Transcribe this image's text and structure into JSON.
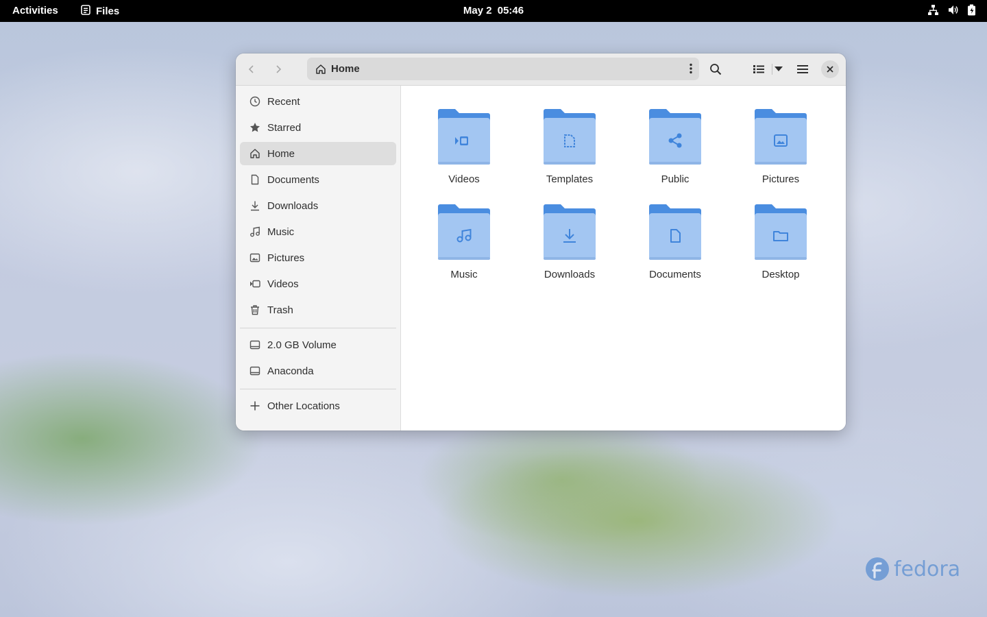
{
  "topbar": {
    "activities": "Activities",
    "app_name": "Files",
    "date": "May 2",
    "time": "05:46",
    "status_icons": [
      "network-icon",
      "volume-icon",
      "battery-icon"
    ]
  },
  "window": {
    "path": "Home",
    "buttons": [
      "back",
      "forward",
      "path-menu",
      "search",
      "view-toggle",
      "view-options",
      "main-menu",
      "close"
    ]
  },
  "sidebar": {
    "items": [
      {
        "label": "Recent",
        "icon": "clock-icon"
      },
      {
        "label": "Starred",
        "icon": "star-icon"
      },
      {
        "label": "Home",
        "icon": "home-icon",
        "active": true
      },
      {
        "label": "Documents",
        "icon": "document-icon"
      },
      {
        "label": "Downloads",
        "icon": "download-icon"
      },
      {
        "label": "Music",
        "icon": "music-icon"
      },
      {
        "label": "Pictures",
        "icon": "picture-icon"
      },
      {
        "label": "Videos",
        "icon": "video-icon"
      },
      {
        "label": "Trash",
        "icon": "trash-icon"
      }
    ],
    "devices": [
      {
        "label": "2.0 GB Volume",
        "icon": "drive-icon"
      },
      {
        "label": "Anaconda",
        "icon": "drive-icon"
      }
    ],
    "other": {
      "label": "Other Locations",
      "icon": "plus-icon"
    }
  },
  "files": [
    {
      "name": "Videos",
      "emblem": "video-icon"
    },
    {
      "name": "Templates",
      "emblem": "template-icon"
    },
    {
      "name": "Public",
      "emblem": "share-icon"
    },
    {
      "name": "Pictures",
      "emblem": "picture-icon"
    },
    {
      "name": "Music",
      "emblem": "music-icon"
    },
    {
      "name": "Downloads",
      "emblem": "download-icon"
    },
    {
      "name": "Documents",
      "emblem": "document-icon"
    },
    {
      "name": "Desktop",
      "emblem": "folder-icon"
    }
  ],
  "colors": {
    "folder_back": "#4a8de0",
    "folder_front": "#a3c6f2",
    "folder_emblem": "#3f84db",
    "accent": "#3584e4"
  },
  "wallpaper": {
    "brand": "fedora"
  }
}
